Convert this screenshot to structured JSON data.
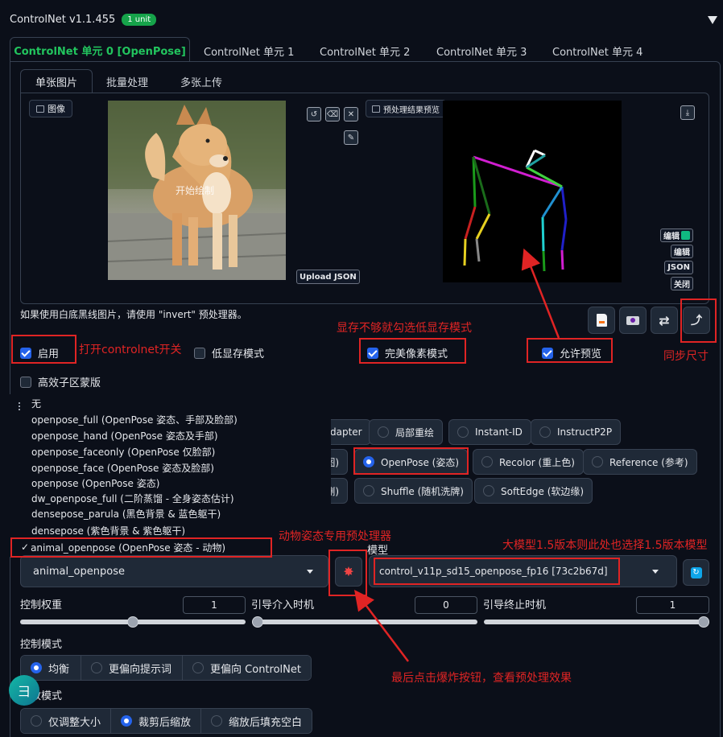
{
  "header": {
    "title": "ControlNet v1.1.455",
    "badge": "1 unit",
    "collapse_icon": "triangle-down-icon"
  },
  "unit_tabs": [
    {
      "label": "ControlNet 单元 0 [OpenPose]",
      "active": true
    },
    {
      "label": "ControlNet 单元 1",
      "active": false
    },
    {
      "label": "ControlNet 单元 2",
      "active": false
    },
    {
      "label": "ControlNet 单元 3",
      "active": false
    },
    {
      "label": "ControlNet 单元 4",
      "active": false
    }
  ],
  "image_tabs": [
    {
      "label": "单张图片",
      "active": true
    },
    {
      "label": "批量处理",
      "active": false
    },
    {
      "label": "多张上传",
      "active": false
    }
  ],
  "input_image": {
    "label": "图像",
    "overlay_text": "开始绘制",
    "upload_json": "Upload JSON"
  },
  "preview": {
    "label": "预处理结果预览",
    "side_buttons": [
      "编辑",
      "编辑",
      "JSON",
      "关闭"
    ]
  },
  "hint_text": "如果使用白底黑线图片，请使用 \"invert\" 预处理器。",
  "checkboxes": {
    "enable": {
      "label": "启用",
      "checked": true
    },
    "low_vram": {
      "label": "低显存模式",
      "checked": false
    },
    "pixel_perfect": {
      "label": "完美像素模式",
      "checked": true
    },
    "allow_preview": {
      "label": "允许预览",
      "checked": true
    },
    "efficient_subregion": {
      "label": "高效子区蒙版",
      "checked": false
    }
  },
  "preprocessor_dropdown": {
    "options": [
      "无",
      "openpose_full (OpenPose 姿态、手部及脸部)",
      "openpose_hand (OpenPose 姿态及手部)",
      "openpose_faceonly (OpenPose 仅脸部)",
      "openpose_face (OpenPose 姿态及脸部)",
      "openpose (OpenPose 姿态)",
      "dw_openpose_full (二阶蒸馏 - 全身姿态估计)",
      "densepose_parula (黑色背景 & 蓝色躯干)",
      "densepose (紫色背景 & 紫色躯干)",
      "animal_openpose (OpenPose 姿态 - 动物)"
    ],
    "checkmark": "✓",
    "selected": "animal_openpose"
  },
  "control_types": {
    "row1": [
      "dapter",
      "局部重绘",
      "Instant-ID",
      "InstructP2P"
    ],
    "row2": [
      "图)",
      "OpenPose (姿态)",
      "Recolor (重上色)",
      "Reference (参考)"
    ],
    "row3": [
      "删)",
      "Shuffle (随机洗牌)",
      "SoftEdge (软边缘)"
    ]
  },
  "model": {
    "label": "模型",
    "value": "control_v11p_sd15_openpose_fp16 [73c2b67d]"
  },
  "sliders": {
    "weight": {
      "label": "控制权重",
      "value": "1",
      "fraction": 0.5
    },
    "start": {
      "label": "引导介入时机",
      "value": "0",
      "fraction": 0.0
    },
    "end": {
      "label": "引导终止时机",
      "value": "1",
      "fraction": 1.0
    }
  },
  "control_mode": {
    "label": "控制模式",
    "options": [
      {
        "label": "均衡",
        "selected": true
      },
      {
        "label": "更偏向提示词",
        "selected": false
      },
      {
        "label": "更偏向 ControlNet",
        "selected": false
      }
    ]
  },
  "resize_mode": {
    "label": "缩放模式",
    "options": [
      {
        "label": "仅调整大小",
        "selected": false
      },
      {
        "label": "裁剪后缩放",
        "selected": true
      },
      {
        "label": "缩放后填充空白",
        "selected": false
      }
    ]
  },
  "annotations": {
    "enable": "打开controlnet开关",
    "low_vram": "显存不够就勾选低显存模式",
    "sync": "同步尺寸",
    "animal": "动物姿态专用预处理器",
    "model_hint": "大模型1.5版本则此处也选择1.5版本模型",
    "explode": "最后点击爆炸按钮，查看预处理效果"
  },
  "colors": {
    "accent": "#2563eb",
    "badge": "#16a34a",
    "active_tab": "#22c55e",
    "annotation": "#e02424",
    "background": "#0b0f19"
  }
}
